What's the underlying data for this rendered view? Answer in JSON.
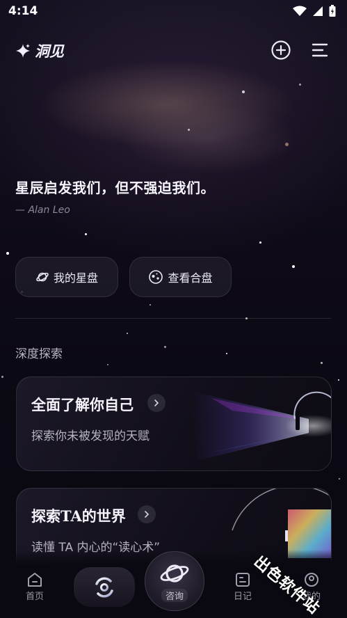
{
  "status_bar": {
    "time": "4:14"
  },
  "header": {
    "app_name": "洞见"
  },
  "quote": {
    "text": "星辰启发我们，但不强迫我们。",
    "author": "— Alan Leo"
  },
  "actions": [
    {
      "label": "我的星盘",
      "icon": "planet-icon"
    },
    {
      "label": "查看合盘",
      "icon": "synastry-icon"
    }
  ],
  "section": {
    "title": "深度探索"
  },
  "cards": [
    {
      "title": "全面了解你自己",
      "subtitle": "探索你未被发现的天赋"
    },
    {
      "title": "探索TA的世界",
      "subtitle": "读懂 TA 内心的“读心术”"
    }
  ],
  "bottom_nav": {
    "home": "首页",
    "consult": "咨询",
    "diary": "日记",
    "mine": "我的"
  },
  "watermark": "出色软件站"
}
